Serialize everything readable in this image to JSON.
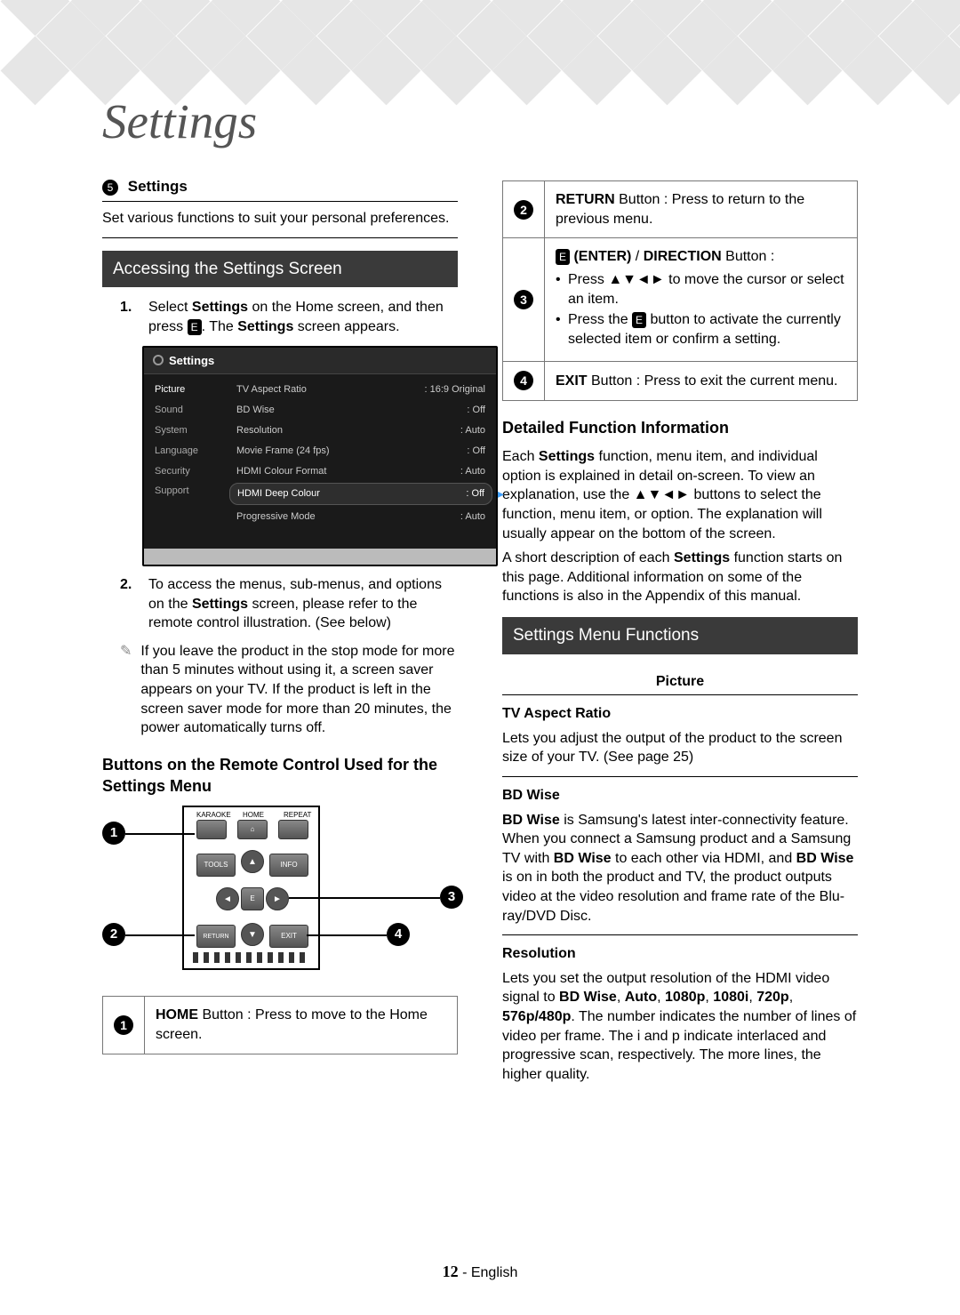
{
  "pageTitle": "Settings",
  "settingsSection": {
    "circledNum": "5",
    "label": "Settings",
    "desc": "Set various functions to suit your personal preferences."
  },
  "accessHeader": "Accessing the Settings Screen",
  "step1_pre": "Select ",
  "step1_b1": "Settings",
  "step1_mid": " on the Home screen, and then press ",
  "step1_post": ". The ",
  "step1_b2": "Settings",
  "step1_end": " screen appears.",
  "screenshot": {
    "title": "Settings",
    "sidebar": [
      {
        "label": "Picture",
        "active": true
      },
      {
        "label": "Sound"
      },
      {
        "label": "System"
      },
      {
        "label": "Language"
      },
      {
        "label": "Security"
      },
      {
        "label": "Support"
      }
    ],
    "rows": [
      {
        "k": "TV Aspect Ratio",
        "v": ": 16:9 Original"
      },
      {
        "k": "BD Wise",
        "v": ": Off"
      },
      {
        "k": "Resolution",
        "v": ": Auto"
      },
      {
        "k": "Movie Frame (24 fps)",
        "v": ": Off"
      },
      {
        "k": "HDMI Colour Format",
        "v": ": Auto"
      },
      {
        "k": "HDMI Deep Colour",
        "v": ": Off",
        "hilite": true
      },
      {
        "k": "Progressive Mode",
        "v": ": Auto"
      }
    ]
  },
  "step2_pre": "To access the menus, sub-menus, and options on the ",
  "step2_b": "Settings",
  "step2_post": " screen, please refer to the remote control illustration. (See below)",
  "noteSym": "✎",
  "noteText": "If you leave the product in the stop mode for more than 5 minutes without using it, a screen saver appears on your TV. If the product is left in the screen saver mode for more than 20 minutes, the power automatically turns off.",
  "remoteHeader": "Buttons on the Remote Control Used for the Settings Menu",
  "remote": {
    "labels": {
      "karaoke": "KARAOKE",
      "home": "HOME",
      "repeat": "REPEAT",
      "tools": "TOOLS",
      "info": "INFO",
      "return": "RETURN",
      "exit": "EXIT"
    },
    "callouts": {
      "1": "1",
      "2": "2",
      "3": "3",
      "4": "4"
    }
  },
  "btnDesc": {
    "row1_b": "HOME",
    "row1_t": " Button : Press to move to the Home screen.",
    "row2_b": "RETURN",
    "row2_t": " Button : Press to return to the previous menu.",
    "row3_pre": "(ENTER)",
    "row3_mid": " / ",
    "row3_b": "DIRECTION",
    "row3_post": " Button :",
    "row3_li1": "Press ▲▼◄► to move the cursor or select an item.",
    "row3_li2_pre": "Press the ",
    "row3_li2_post": " button to activate the currently selected item or confirm a setting.",
    "row4_b": "EXIT",
    "row4_t": " Button : Press to exit the current menu."
  },
  "detailHeader": "Detailed Function Information",
  "detail_p1_pre": "Each ",
  "detail_p1_b": "Settings",
  "detail_p1_post": " function, menu item, and individual option is explained in detail on-screen. To view an explanation, use the ▲▼◄► buttons to select the function, menu item, or option. The explanation will usually appear on the bottom of the screen.",
  "detail_p2_pre": "A short description of each ",
  "detail_p2_b": "Settings",
  "detail_p2_post": " function starts on this page. Additional information on some of the functions is also in the Appendix of this manual.",
  "menuFuncHeader": "Settings Menu Functions",
  "funcCategory": "Picture",
  "func": {
    "tvAspect": {
      "title": "TV Aspect Ratio",
      "body": "Lets you adjust the output of the product to the screen size of your TV. (See page 25)"
    },
    "bdWise": {
      "title": "BD Wise",
      "b1": "BD Wise",
      "t1": " is Samsung's latest inter-connectivity feature. When you connect a Samsung product and a Samsung TV with ",
      "b2": "BD Wise",
      "t2": " to each other via HDMI, and ",
      "b3": "BD Wise",
      "t3": " is on in both the product and TV, the product outputs video at the video resolution and frame rate of the Blu-ray/DVD Disc."
    },
    "resolution": {
      "title": "Resolution",
      "t1": "Lets you set the output resolution of the HDMI video signal to ",
      "b_list": [
        "BD Wise",
        "Auto",
        "1080p",
        "1080i",
        "720p",
        "576p/480p"
      ],
      "t2": ". The number indicates the number of lines of video per frame. The i and p indicate interlaced and progressive scan, respectively. The more lines, the higher quality."
    }
  },
  "footer": {
    "page": "12",
    "lang": "English"
  }
}
